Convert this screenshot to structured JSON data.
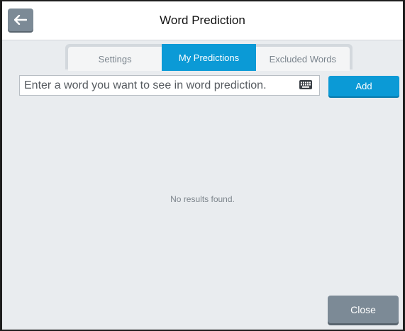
{
  "window": {
    "title": "Word Prediction"
  },
  "icons": {
    "back": "left-arrow-icon",
    "keyboard": "keyboard-icon"
  },
  "tabs": [
    {
      "label": "Settings",
      "active": false
    },
    {
      "label": "My Predictions",
      "active": true
    },
    {
      "label": "Excluded Words",
      "active": false
    }
  ],
  "input": {
    "placeholder": "Enter a word you want to see in word prediction.",
    "value": ""
  },
  "buttons": {
    "add_label": "Add",
    "close_label": "Close"
  },
  "results": {
    "empty_message": "No results found."
  },
  "colors": {
    "accent": "#0b9ad6",
    "secondary_button": "#7c8a96",
    "background": "#e9ecef"
  }
}
